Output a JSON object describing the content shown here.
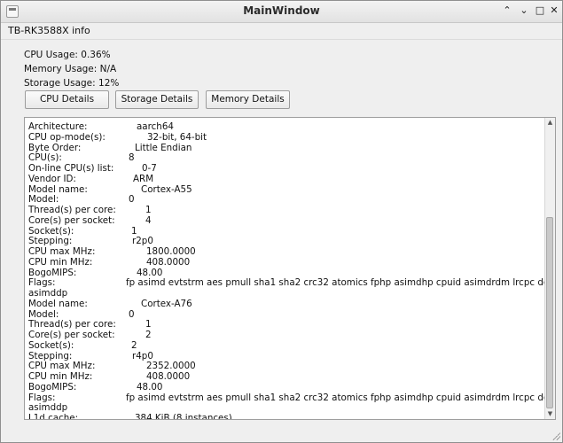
{
  "window": {
    "title": "MainWindow",
    "minimize_glyph": "⌃",
    "restore_glyph": "⌄",
    "maximize_glyph": "□",
    "close_glyph": "✕"
  },
  "menubar": {
    "items": [
      "TB-RK3588X info"
    ]
  },
  "stats": {
    "cpu_usage": "CPU Usage: 0.36%",
    "memory_usage": "Memory Usage: N/A",
    "storage_usage": "Storage Usage: 12%"
  },
  "buttons": {
    "cpu_details": "CPU Details",
    "storage_details": "Storage Details",
    "memory_details": "Memory Details"
  },
  "details_text": {
    "lines": [
      {
        "key": "Architecture:",
        "value": "aarch64",
        "vx": 122
      },
      {
        "key": "CPU op-mode(s):",
        "value": "32-bit, 64-bit",
        "vx": 134
      },
      {
        "key": "Byte Order:",
        "value": "Little Endian",
        "vx": 120
      },
      {
        "key": "CPU(s):",
        "value": "8",
        "vx": 113
      },
      {
        "key": "On-line CPU(s) list:",
        "value": "0-7",
        "vx": 128
      },
      {
        "key": "Vendor ID:",
        "value": "ARM",
        "vx": 118
      },
      {
        "key": "Model name:",
        "value": "Cortex-A55",
        "vx": 127
      },
      {
        "key": "Model:",
        "value": "0",
        "vx": 113
      },
      {
        "key": "Thread(s) per core:",
        "value": "1",
        "vx": 132
      },
      {
        "key": "Core(s) per socket:",
        "value": "4",
        "vx": 132
      },
      {
        "key": "Socket(s):",
        "value": "1",
        "vx": 116
      },
      {
        "key": "Stepping:",
        "value": "r2p0",
        "vx": 117
      },
      {
        "key": "CPU max MHz:",
        "value": "1800.0000",
        "vx": 133
      },
      {
        "key": "CPU min MHz:",
        "value": "408.0000",
        "vx": 133
      },
      {
        "key": "BogoMIPS:",
        "value": "48.00",
        "vx": 122
      },
      {
        "key": "Flags:",
        "value": "fp asimd evtstrm aes pmull sha1 sha2 crc32 atomics fphp asimdhp cpuid asimdrdm lrcpc dcpop",
        "vx": 110
      },
      {
        "key": "asimddp",
        "value": "",
        "vx": 0
      },
      {
        "key": "Model name:",
        "value": "Cortex-A76",
        "vx": 127
      },
      {
        "key": "Model:",
        "value": "0",
        "vx": 113
      },
      {
        "key": "Thread(s) per core:",
        "value": "1",
        "vx": 132
      },
      {
        "key": "Core(s) per socket:",
        "value": "2",
        "vx": 132
      },
      {
        "key": "Socket(s):",
        "value": "2",
        "vx": 116
      },
      {
        "key": "Stepping:",
        "value": "r4p0",
        "vx": 117
      },
      {
        "key": "CPU max MHz:",
        "value": "2352.0000",
        "vx": 133
      },
      {
        "key": "CPU min MHz:",
        "value": "408.0000",
        "vx": 133
      },
      {
        "key": "BogoMIPS:",
        "value": "48.00",
        "vx": 122
      },
      {
        "key": "Flags:",
        "value": "fp asimd evtstrm aes pmull sha1 sha2 crc32 atomics fphp asimdhp cpuid asimdrdm lrcpc dcpop",
        "vx": 110
      },
      {
        "key": "asimddp",
        "value": "",
        "vx": 0
      },
      {
        "key": "L1d cache:",
        "value": "384 KiB (8 instances)",
        "vx": 120
      }
    ]
  },
  "scrollbar": {
    "up_glyph": "▲",
    "down_glyph": "▼"
  }
}
